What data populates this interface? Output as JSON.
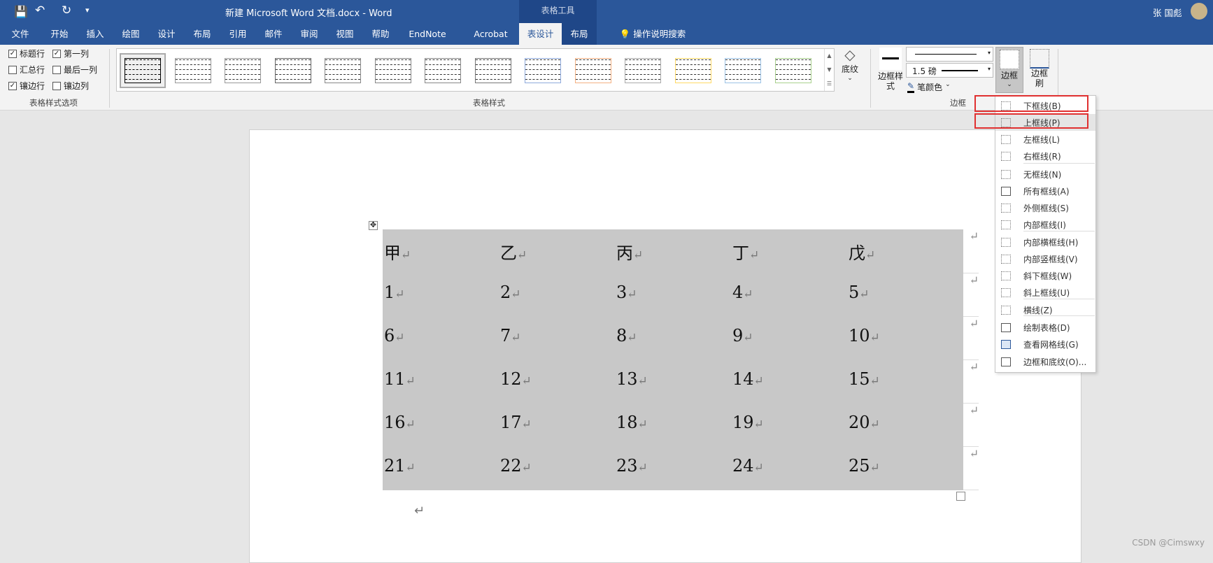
{
  "titlebar": {
    "doc_title": "新建 Microsoft Word 文档.docx  -  Word",
    "context_group": "表格工具",
    "user_name": "张 国彪"
  },
  "tabs": [
    "文件",
    "开始",
    "插入",
    "绘图",
    "设计",
    "布局",
    "引用",
    "邮件",
    "审阅",
    "视图",
    "帮助",
    "EndNote 20",
    "Acrobat",
    "表设计",
    "布局"
  ],
  "active_tab": "表设计",
  "tell_me": "操作说明搜索",
  "style_options": {
    "label": "表格样式选项",
    "items": [
      {
        "label": "标题行",
        "checked": true
      },
      {
        "label": "第一列",
        "checked": true
      },
      {
        "label": "汇总行",
        "checked": false
      },
      {
        "label": "最后一列",
        "checked": false
      },
      {
        "label": "镶边行",
        "checked": true
      },
      {
        "label": "镶边列",
        "checked": false
      }
    ]
  },
  "table_styles": {
    "label": "表格样式",
    "thumb_colors": [
      "#000000",
      "#999999",
      "#999999",
      "#666666",
      "#888888",
      "#888888",
      "#888888",
      "#777777",
      "#8faadc",
      "#f4b183",
      "#aaaaaa",
      "#ffd966",
      "#9dc3e6",
      "#a9d18e"
    ]
  },
  "shading": {
    "label": "底纹"
  },
  "borders": {
    "group_label": "边框",
    "style_label": "边框样式",
    "weight": "1.5 磅",
    "pen_color": "笔颜色",
    "borders_button": "边框",
    "painter": "边框刷"
  },
  "menu": {
    "items": [
      {
        "label": "下框线(B)",
        "icon": "bottom-border"
      },
      {
        "label": "上框线(P)",
        "icon": "top-border"
      },
      {
        "label": "左框线(L)",
        "icon": "left-border"
      },
      {
        "label": "右框线(R)",
        "icon": "right-border"
      },
      {
        "label": "无框线(N)",
        "icon": "no-border"
      },
      {
        "label": "所有框线(A)",
        "icon": "all-borders"
      },
      {
        "label": "外侧框线(S)",
        "icon": "outside-borders"
      },
      {
        "label": "内部框线(I)",
        "icon": "inside-borders"
      },
      {
        "label": "内部横框线(H)",
        "icon": "inside-horizontal"
      },
      {
        "label": "内部竖框线(V)",
        "icon": "inside-vertical"
      },
      {
        "label": "斜下框线(W)",
        "icon": "diagonal-down"
      },
      {
        "label": "斜上框线(U)",
        "icon": "diagonal-up"
      },
      {
        "label": "横线(Z)",
        "icon": "horizontal-line"
      },
      {
        "label": "绘制表格(D)",
        "icon": "draw-table"
      },
      {
        "label": "查看网格线(G)",
        "icon": "view-gridlines"
      },
      {
        "label": "边框和底纹(O)...",
        "icon": "borders-shading"
      }
    ]
  },
  "table": {
    "rows": [
      [
        "甲",
        "乙",
        "丙",
        "丁",
        "戊"
      ],
      [
        "1",
        "2",
        "3",
        "4",
        "5"
      ],
      [
        "6",
        "7",
        "8",
        "9",
        "10"
      ],
      [
        "11",
        "12",
        "13",
        "14",
        "15"
      ],
      [
        "16",
        "17",
        "18",
        "19",
        "20"
      ],
      [
        "21",
        "22",
        "23",
        "24",
        "25"
      ]
    ],
    "return_mark": "↵"
  },
  "watermark": "CSDN @Cimswxy"
}
